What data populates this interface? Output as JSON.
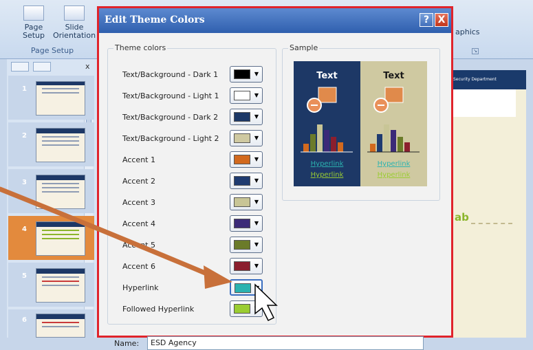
{
  "ribbon": {
    "page_setup_label": "Page\nSetup",
    "slide_orientation_label": "Slide\nOrientation",
    "group_label": "Page Setup",
    "right_text": "aphics"
  },
  "slides": {
    "close_label": "x",
    "numbers": [
      "1",
      "2",
      "3",
      "4",
      "5",
      "6"
    ],
    "selected_index": 4
  },
  "background_slide": {
    "header_text": "Security Department",
    "lab_text": "ab"
  },
  "dialog": {
    "title": "Edit Theme Colors",
    "help_label": "?",
    "close_label": "X",
    "theme_colors_group": "Theme colors",
    "sample_group": "Sample",
    "rows": [
      {
        "label": "Text/Background - Dark 1",
        "color": "#000000"
      },
      {
        "label": "Text/Background - Light 1",
        "color": "#ffffff"
      },
      {
        "label": "Text/Background - Dark 2",
        "color": "#1d3866"
      },
      {
        "label": "Text/Background - Light 2",
        "color": "#cfc9a1"
      },
      {
        "label": "Accent 1",
        "color": "#d2691e"
      },
      {
        "label": "Accent 2",
        "color": "#1f3b70"
      },
      {
        "label": "Accent 3",
        "color": "#c8c596"
      },
      {
        "label": "Accent 4",
        "color": "#3b2a78"
      },
      {
        "label": "Accent 5",
        "color": "#6b7b2a"
      },
      {
        "label": "Accent 6",
        "color": "#8b1f2e"
      },
      {
        "label": "Hyperlink",
        "color": "#2bb3b0"
      },
      {
        "label": "Followed Hyperlink",
        "color": "#9acd32"
      }
    ],
    "sample": {
      "text_label": "Text",
      "hyperlink_label": "Hyperlink",
      "followed_hyperlink_label": "Hyperlink"
    },
    "name_label": "Name:",
    "name_value": "ESD Agency"
  },
  "annotation": {
    "arrow_color": "#c8703a"
  }
}
